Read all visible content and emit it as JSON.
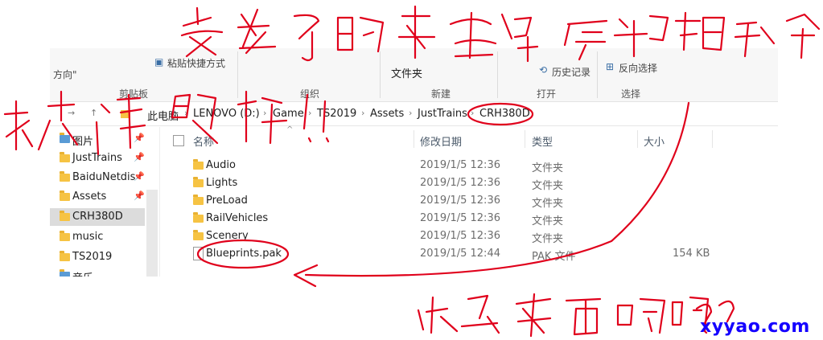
{
  "ribbon": {
    "clipboard_text1": "方向\"",
    "clipboard_paste_shortcut": "粘贴快捷方式",
    "clipboard_label": "剪贴板",
    "organize_label": "组织",
    "new_folder_text": "文件夹",
    "new_label": "新建",
    "history_text": "历史记录",
    "open_label": "打开",
    "invert_text": "反向选择",
    "select_label": "选择"
  },
  "address": {
    "crumbs": [
      "此电脑",
      "LENOVO (D:)",
      "Game",
      "TS2019",
      "Assets",
      "JustTrains",
      "CRH380D"
    ]
  },
  "nav": {
    "items": [
      {
        "label": "图片",
        "pinned": true
      },
      {
        "label": "JustTrains",
        "pinned": true
      },
      {
        "label": "BaiduNetdis",
        "pinned": true
      },
      {
        "label": "Assets",
        "pinned": true
      },
      {
        "label": "CRH380D",
        "pinned": false,
        "selected": true
      },
      {
        "label": "music",
        "pinned": false
      },
      {
        "label": "TS2019",
        "pinned": false
      },
      {
        "label": "音乐",
        "pinned": false
      }
    ],
    "pin_glyph": "📌"
  },
  "columns": {
    "name": "名称",
    "date": "修改日期",
    "type": "类型",
    "size": "大小"
  },
  "files": [
    {
      "name": "Audio",
      "date": "2019/1/5 12:36",
      "type": "文件夹",
      "size": "",
      "kind": "folder"
    },
    {
      "name": "Lights",
      "date": "2019/1/5 12:36",
      "type": "文件夹",
      "size": "",
      "kind": "folder"
    },
    {
      "name": "PreLoad",
      "date": "2019/1/5 12:36",
      "type": "文件夹",
      "size": "",
      "kind": "folder"
    },
    {
      "name": "RailVehicles",
      "date": "2019/1/5 12:36",
      "type": "文件夹",
      "size": "",
      "kind": "folder"
    },
    {
      "name": "Scenery",
      "date": "2019/1/5 12:36",
      "type": "文件夹",
      "size": "",
      "kind": "folder"
    },
    {
      "name": "Blueprints.pak",
      "date": "2019/1/5 12:44",
      "type": "PAK 文件",
      "size": "154 KB",
      "kind": "file"
    }
  ],
  "watermark": "xyyao.com",
  "colors": {
    "annotation": "#e0001b",
    "watermark": "#1400ff",
    "folder": "#f6c343"
  }
}
